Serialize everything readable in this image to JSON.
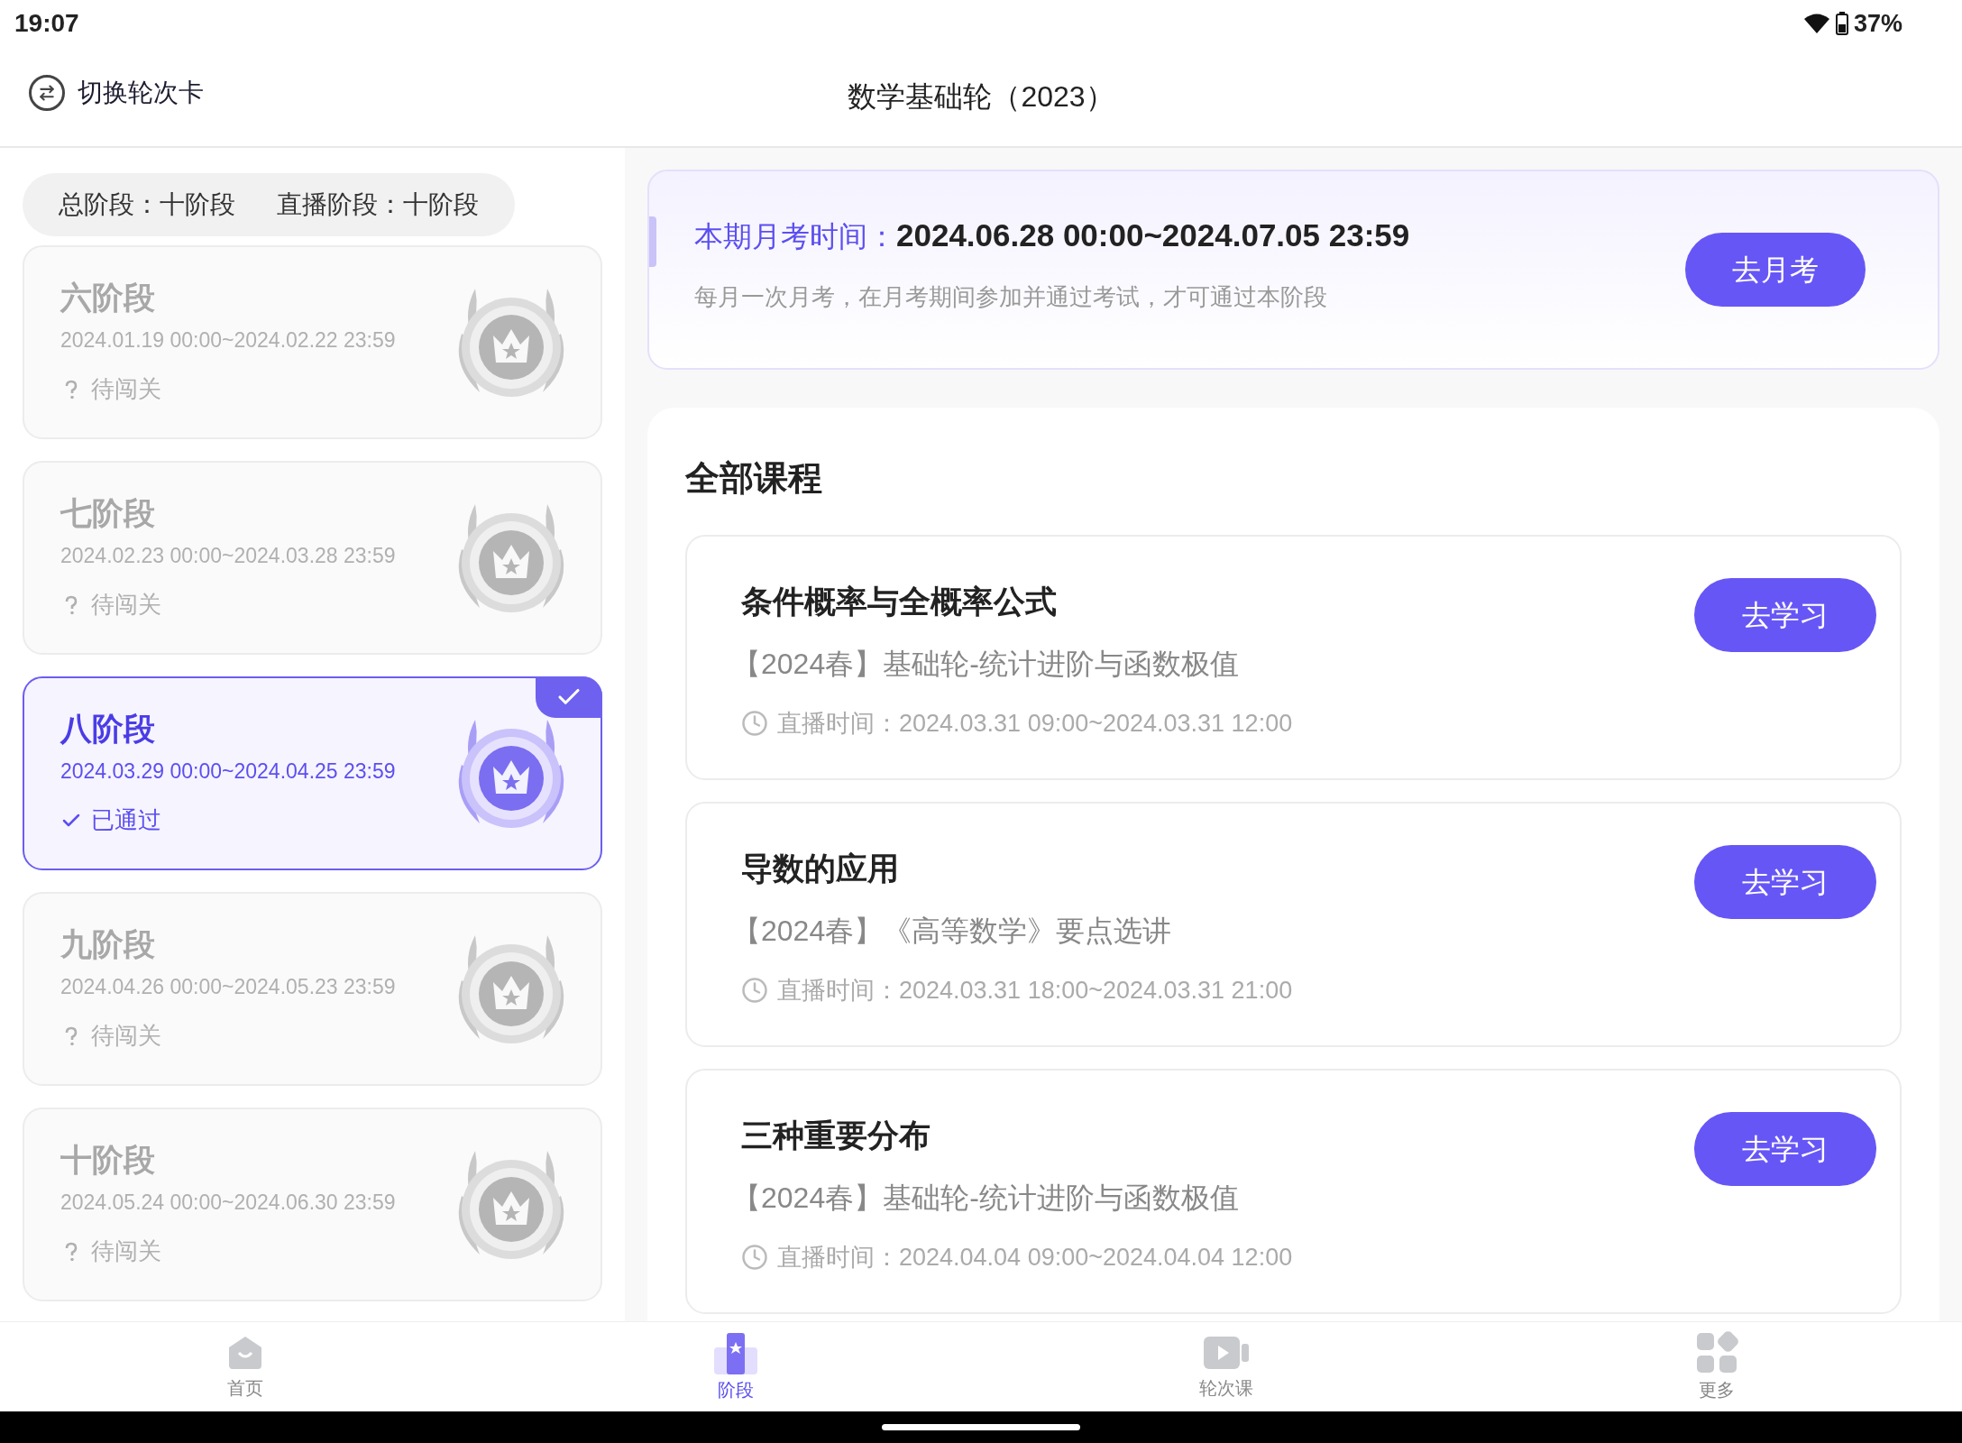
{
  "status_bar": {
    "time": "19:07",
    "battery": "37%"
  },
  "header": {
    "switch_label": "切换轮次卡",
    "title": "数学基础轮（2023）"
  },
  "summary": [
    "总阶段：十阶段",
    "直播阶段：十阶段"
  ],
  "stages": [
    {
      "name": "六阶段",
      "dates": "2024.01.19 00:00~2024.02.22 23:59",
      "kind": "pending",
      "status_label": "待闯关",
      "selected": false
    },
    {
      "name": "七阶段",
      "dates": "2024.02.23 00:00~2024.03.28 23:59",
      "kind": "pending",
      "status_label": "待闯关",
      "selected": false
    },
    {
      "name": "八阶段",
      "dates": "2024.03.29 00:00~2024.04.25 23:59",
      "kind": "passed",
      "status_label": "已通过",
      "selected": true
    },
    {
      "name": "九阶段",
      "dates": "2024.04.26 00:00~2024.05.23 23:59",
      "kind": "pending",
      "status_label": "待闯关",
      "selected": false
    },
    {
      "name": "十阶段",
      "dates": "2024.05.24 00:00~2024.06.30 23:59",
      "kind": "pending",
      "status_label": "待闯关",
      "selected": false
    }
  ],
  "exam": {
    "label": "本期月考时间：",
    "time": "2024.06.28 00:00~2024.07.05 23:59",
    "note": "每月一次月考，在月考期间参加并通过考试，才可通过本阶段",
    "button": "去月考"
  },
  "courses": {
    "title": "全部课程",
    "items": [
      {
        "title": "条件概率与全概率公式",
        "subtitle": "【2024春】基础轮-统计进阶与函数极值",
        "live_label": "直播时间：",
        "live_time": "2024.03.31 09:00~2024.03.31 12:00",
        "button": "去学习"
      },
      {
        "title": "导数的应用",
        "subtitle": "【2024春】《高等数学》要点选讲",
        "live_label": "直播时间：",
        "live_time": "2024.03.31 18:00~2024.03.31 21:00",
        "button": "去学习"
      },
      {
        "title": "三种重要分布",
        "subtitle": "【2024春】基础轮-统计进阶与函数极值",
        "live_label": "直播时间：",
        "live_time": "2024.04.04 09:00~2024.04.04 12:00",
        "button": "去学习"
      }
    ]
  },
  "nav": [
    {
      "label": "首页",
      "kind": "home",
      "selected": false
    },
    {
      "label": "阶段",
      "kind": "stage",
      "selected": true
    },
    {
      "label": "轮次课",
      "kind": "video",
      "selected": false
    },
    {
      "label": "更多",
      "kind": "more",
      "selected": false
    }
  ]
}
